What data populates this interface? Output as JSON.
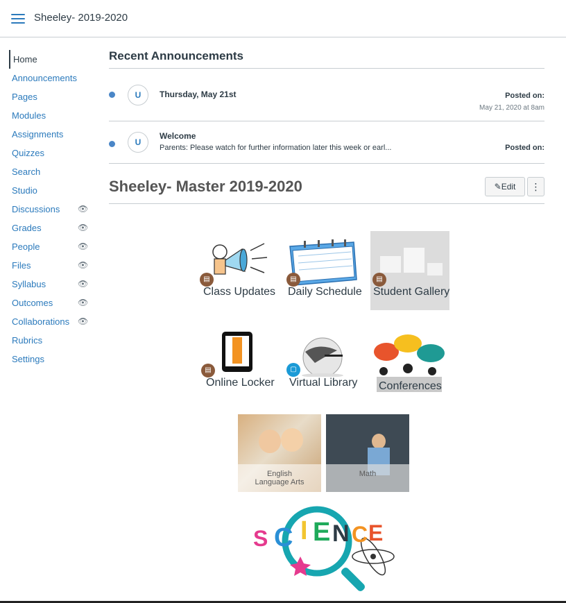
{
  "header": {
    "course_title": "Sheeley- 2019-2020"
  },
  "sidebar": {
    "items": [
      {
        "label": "Home",
        "hidden": false
      },
      {
        "label": "Announcements",
        "hidden": false
      },
      {
        "label": "Pages",
        "hidden": false
      },
      {
        "label": "Modules",
        "hidden": false
      },
      {
        "label": "Assignments",
        "hidden": false
      },
      {
        "label": "Quizzes",
        "hidden": false
      },
      {
        "label": "Search",
        "hidden": false
      },
      {
        "label": "Studio",
        "hidden": false
      },
      {
        "label": "Discussions",
        "hidden": true
      },
      {
        "label": "Grades",
        "hidden": true
      },
      {
        "label": "People",
        "hidden": true
      },
      {
        "label": "Files",
        "hidden": true
      },
      {
        "label": "Syllabus",
        "hidden": true
      },
      {
        "label": "Outcomes",
        "hidden": true
      },
      {
        "label": "Collaborations",
        "hidden": true
      },
      {
        "label": "Rubrics",
        "hidden": false
      },
      {
        "label": "Settings",
        "hidden": false
      }
    ]
  },
  "announcements": {
    "title": "Recent Announcements",
    "items": [
      {
        "avatar": "U",
        "title": "Thursday, May 21st",
        "message": "",
        "posted_label": "Posted on:",
        "posted_date": "May 21, 2020 at 8am"
      },
      {
        "avatar": "U",
        "title": "Welcome",
        "message": "Parents: Please watch for further information later this week or earl...",
        "posted_label": "Posted on:",
        "posted_date": ""
      }
    ]
  },
  "page": {
    "title": "Sheeley- Master 2019-2020",
    "edit_label": "Edit",
    "more_label": "⋮"
  },
  "tiles": [
    {
      "label": "Class Updates"
    },
    {
      "label": "Daily Schedule"
    },
    {
      "label": "Student Gallery"
    },
    {
      "label": "Online Locker"
    },
    {
      "label": "Virtual Library"
    },
    {
      "label": "Conferences"
    }
  ],
  "photos": [
    {
      "caption_line1": "English",
      "caption_line2": "Language Arts"
    },
    {
      "caption_line1": "Math",
      "caption_line2": ""
    }
  ],
  "science": {
    "letters": [
      "S",
      "C",
      "I",
      "E",
      "N",
      "C",
      "E"
    ]
  },
  "colors": {
    "link": "#2b7abc",
    "text": "#2d3b45",
    "dot": "#4a86c7",
    "badge": "#8a5a3b",
    "badge_blue": "#1b9ad6"
  }
}
